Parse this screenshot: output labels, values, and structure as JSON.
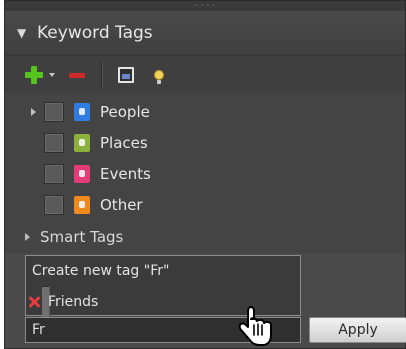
{
  "panel": {
    "grip": "· · · ·",
    "header": {
      "title": "Keyword Tags"
    }
  },
  "toolbar": {
    "items": [
      {
        "name": "add-tag",
        "icon": "plus-icon"
      },
      {
        "name": "add-options",
        "icon": "chevron-down-icon"
      },
      {
        "name": "delete-tag",
        "icon": "minus-icon"
      },
      {
        "name": "tag-photo",
        "icon": "photo-icon"
      },
      {
        "name": "suggest",
        "icon": "lightbulb-icon"
      }
    ]
  },
  "tags": [
    {
      "label": "People",
      "icon": "people-tag-icon",
      "expandable": true
    },
    {
      "label": "Places",
      "icon": "places-tag-icon",
      "expandable": false
    },
    {
      "label": "Events",
      "icon": "events-tag-icon",
      "expandable": false
    },
    {
      "label": "Other",
      "icon": "other-tag-icon",
      "expandable": false
    }
  ],
  "smart_tags": {
    "label": "Smart Tags"
  },
  "suggestions": [
    {
      "label": "Create new tag \"Fr\""
    },
    {
      "label": "Friends"
    }
  ],
  "search": {
    "value": "Fr"
  },
  "apply_button": {
    "label": "Apply"
  },
  "colors": {
    "panel_bg": "#4a4a4a",
    "accent_add": "#56c41f",
    "accent_delete": "#cc2a2a",
    "people_icon": "#2f7de0",
    "places_icon": "#8bb13a",
    "events_icon": "#e43b79",
    "other_icon": "#f08a1f"
  }
}
